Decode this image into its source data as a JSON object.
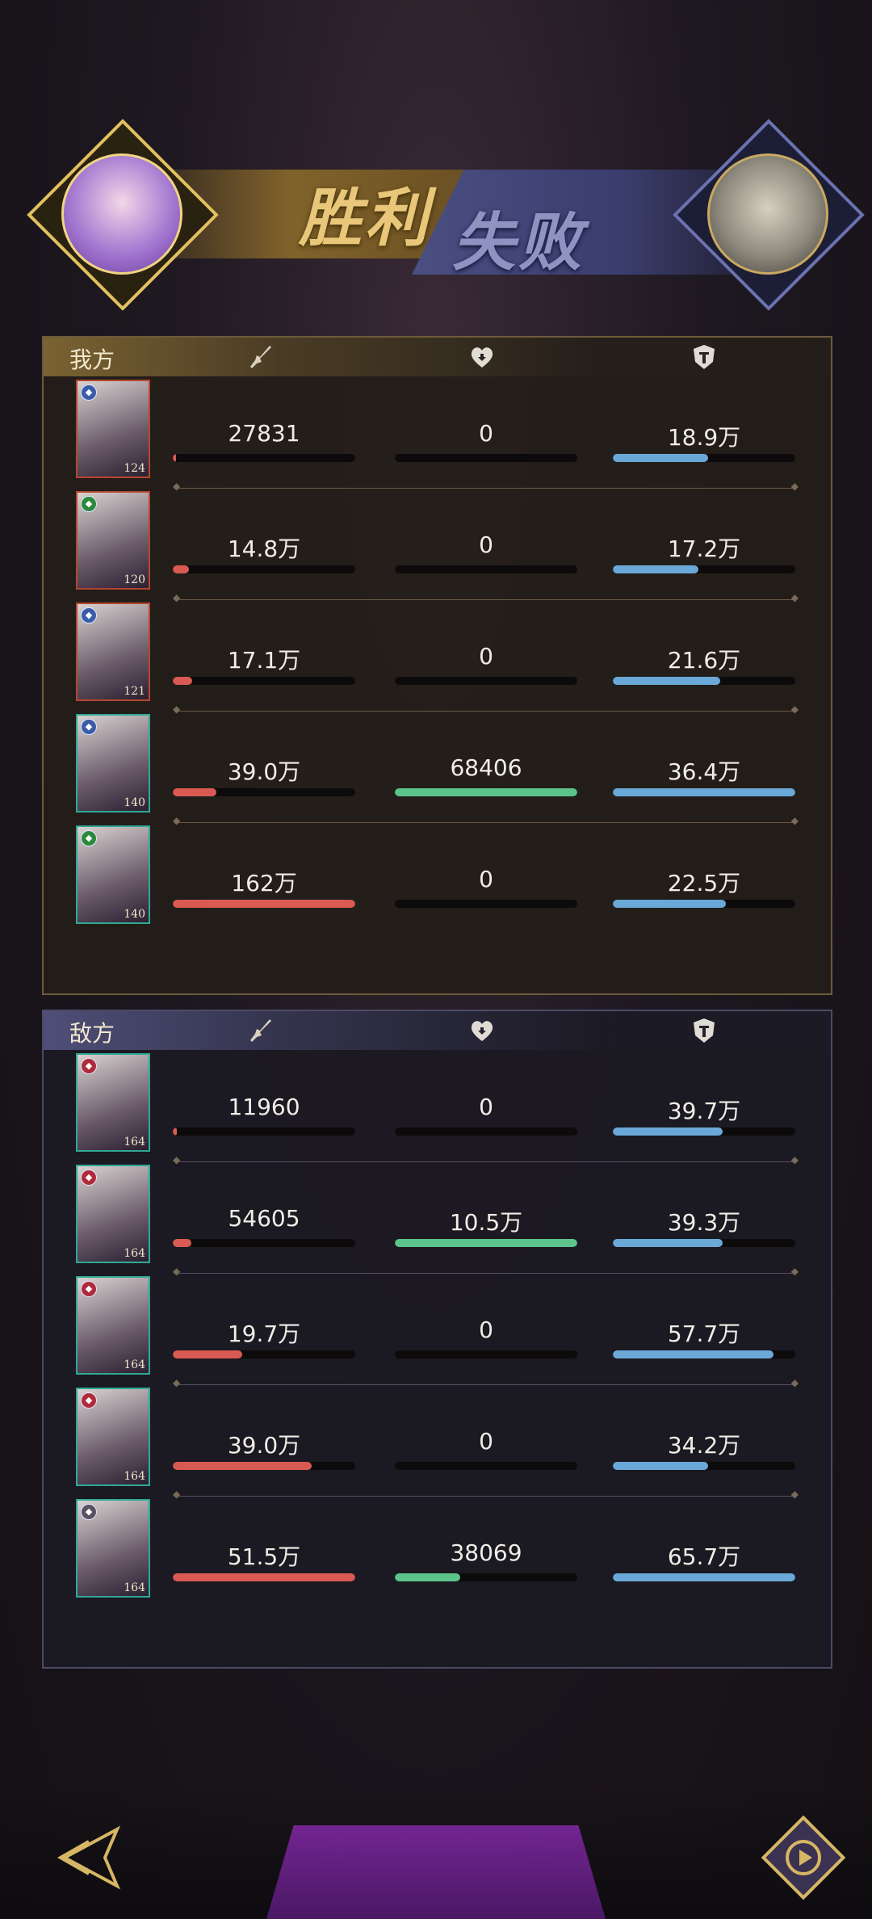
{
  "banner": {
    "win_label": "胜利",
    "lose_label": "失败"
  },
  "ours": {
    "label": "我方",
    "rows": [
      {
        "level": "124",
        "frame": "red",
        "badge": "blue",
        "damage": "27831",
        "damage_frac": 0.017,
        "heal": "0",
        "heal_frac": 0.0,
        "tank": "18.9万",
        "tank_frac": 0.52
      },
      {
        "level": "120",
        "frame": "red",
        "badge": "green",
        "damage": "14.8万",
        "damage_frac": 0.09,
        "heal": "0",
        "heal_frac": 0.0,
        "tank": "17.2万",
        "tank_frac": 0.47
      },
      {
        "level": "121",
        "frame": "red",
        "badge": "blue",
        "damage": "17.1万",
        "damage_frac": 0.105,
        "heal": "0",
        "heal_frac": 0.0,
        "tank": "21.6万",
        "tank_frac": 0.59
      },
      {
        "level": "140",
        "frame": "teal",
        "badge": "blue",
        "damage": "39.0万",
        "damage_frac": 0.24,
        "heal": "68406",
        "heal_frac": 1.0,
        "tank": "36.4万",
        "tank_frac": 1.0
      },
      {
        "level": "140",
        "frame": "teal",
        "badge": "green",
        "damage": "162万",
        "damage_frac": 1.0,
        "heal": "0",
        "heal_frac": 0.0,
        "tank": "22.5万",
        "tank_frac": 0.62
      }
    ]
  },
  "enemy": {
    "label": "敌方",
    "rows": [
      {
        "level": "164",
        "frame": "teal",
        "badge": "red",
        "damage": "11960",
        "damage_frac": 0.02,
        "heal": "0",
        "heal_frac": 0.0,
        "tank": "39.7万",
        "tank_frac": 0.6
      },
      {
        "level": "164",
        "frame": "teal",
        "badge": "red",
        "damage": "54605",
        "damage_frac": 0.1,
        "heal": "10.5万",
        "heal_frac": 1.0,
        "tank": "39.3万",
        "tank_frac": 0.6
      },
      {
        "level": "164",
        "frame": "teal",
        "badge": "red",
        "damage": "19.7万",
        "damage_frac": 0.38,
        "heal": "0",
        "heal_frac": 0.0,
        "tank": "57.7万",
        "tank_frac": 0.88
      },
      {
        "level": "164",
        "frame": "teal",
        "badge": "red",
        "damage": "39.0万",
        "damage_frac": 0.76,
        "heal": "0",
        "heal_frac": 0.0,
        "tank": "34.2万",
        "tank_frac": 0.52
      },
      {
        "level": "164",
        "frame": "teal",
        "badge": "gray",
        "damage": "51.5万",
        "damage_frac": 1.0,
        "heal": "38069",
        "heal_frac": 0.36,
        "tank": "65.7万",
        "tank_frac": 1.0
      }
    ]
  },
  "colors": {
    "damage": "#d85a52",
    "heal": "#5cc48a",
    "tank": "#6aa8d8"
  }
}
